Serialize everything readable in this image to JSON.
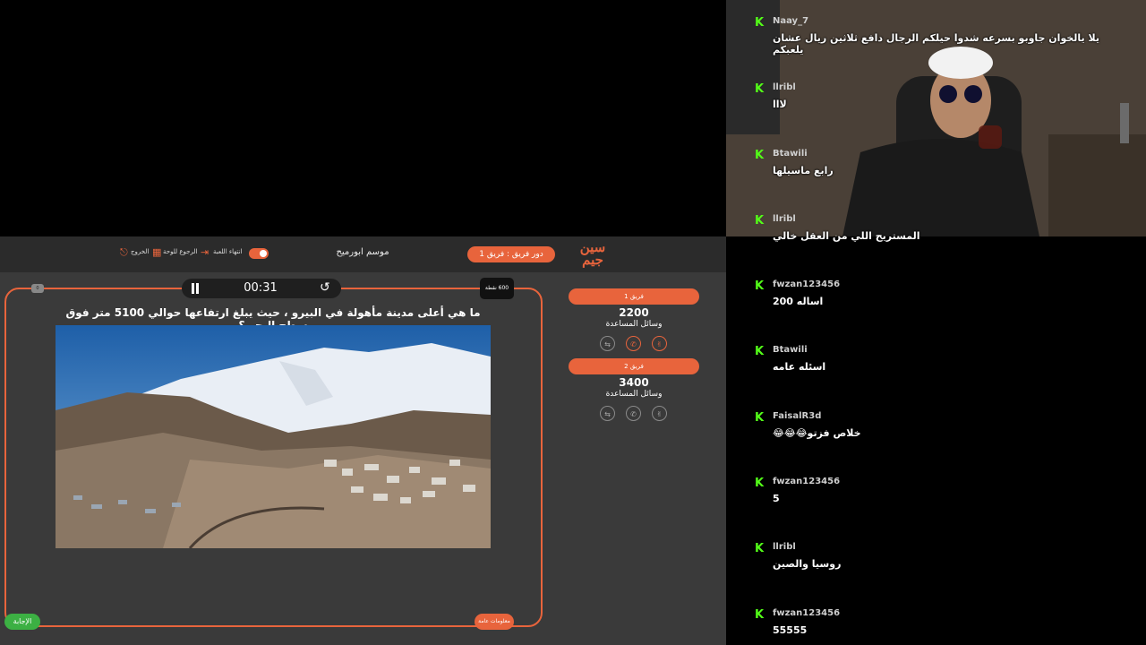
{
  "game": {
    "logo_text": "سين جيم",
    "turn_label": "دور فريق : فريق 1",
    "season_title": "موسم ابورميح",
    "controls": {
      "end_game": "انتهاء اللعبة",
      "back_to_board": "الرجوع للوحة",
      "exit": "الخروج"
    },
    "timer": "00:31",
    "points_badge": "600 نقطة",
    "mini_badge": "0",
    "question": "ما هي أعلى مدينة مأهولة في البيرو ، حيث يبلغ ارتفاعها حوالي 5100 متر فوق سطح البحر ؟",
    "answer_button": "الإجابة",
    "info_button": "معلومات عامة",
    "teams": [
      {
        "name": "فريق 1",
        "score": "2200",
        "aids_label": "وسائل المساعدة"
      },
      {
        "name": "فريق 2",
        "score": "3400",
        "aids_label": "وسائل المساعدة"
      }
    ]
  },
  "chat": {
    "messages": [
      {
        "user": "Naay_7",
        "text": "يلا يالخوان جاوبو بسرعه شدوا حيلكم الرجال دافع ثلاثين ريال عشان يلعبكم"
      },
      {
        "user": "llribl",
        "text": "لااا"
      },
      {
        "user": "Btawili",
        "text": "رابع ماسيلها"
      },
      {
        "user": "llribl",
        "text": "المستريح اللي من العقل خالي"
      },
      {
        "user": "fwzan123456",
        "text": "اساله 200"
      },
      {
        "user": "Btawili",
        "text": "اسئله عامه"
      },
      {
        "user": "FaisalR3d",
        "text": "خلاص فزتو😂😂😂"
      },
      {
        "user": "fwzan123456",
        "text": "5"
      },
      {
        "user": "llribl",
        "text": "روسيا والصين"
      },
      {
        "user": "fwzan123456",
        "text": "55555"
      }
    ]
  },
  "colors": {
    "accent": "#e8643c",
    "kick_green": "#53fc18",
    "answer_green": "#3cb043"
  }
}
